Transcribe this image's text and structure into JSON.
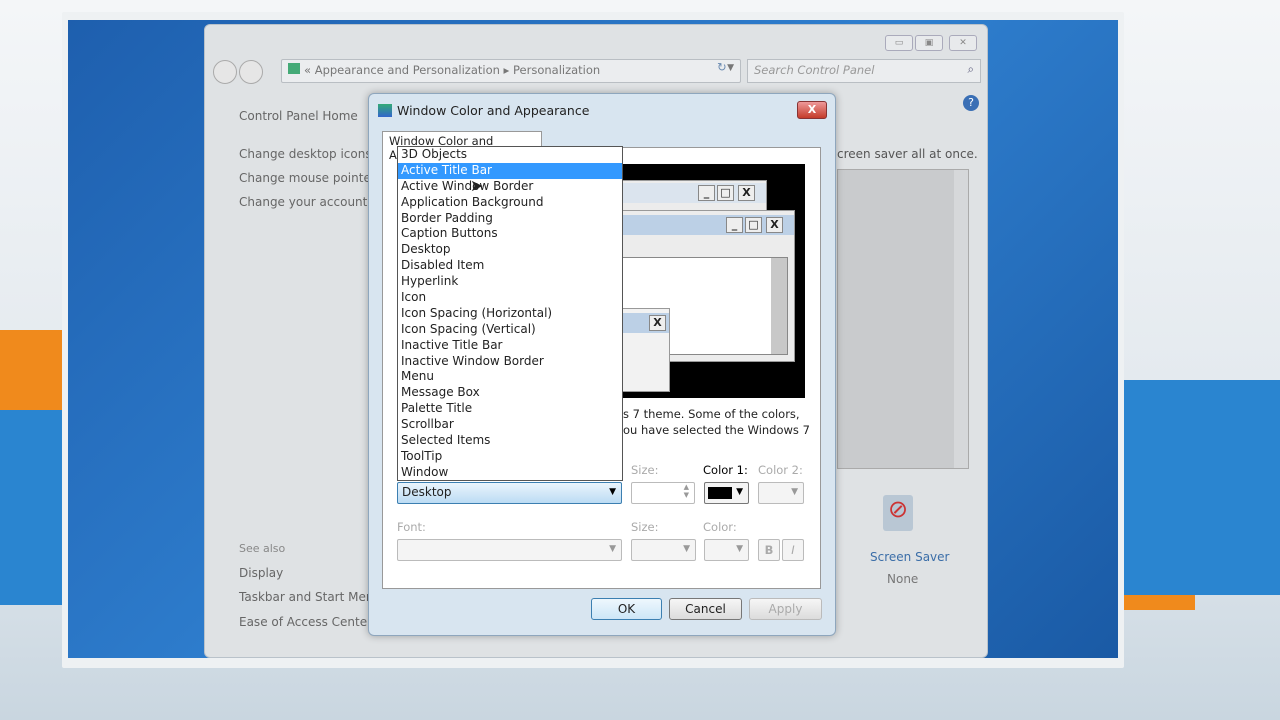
{
  "control_panel": {
    "breadcrumb": [
      "Appearance and Personalization",
      "Personalization"
    ],
    "search_placeholder": "Search Control Panel",
    "sidebar": [
      "Control Panel Home",
      "Change desktop icons",
      "Change mouse pointers",
      "Change your account pi"
    ],
    "see_also": {
      "heading": "See also",
      "items": [
        "Display",
        "Taskbar and Start Menu",
        "Ease of Access Center"
      ]
    },
    "partial_text": "creen saver all at once.",
    "screen_saver": {
      "label": "Screen Saver",
      "value": "None"
    },
    "window_buttons": {
      "minimize": "▭",
      "maximize": "▣",
      "close": "✕"
    }
  },
  "dialog": {
    "title": "Window Color and Appearance",
    "tab": "Window Color and Appearance",
    "close": "X",
    "description": [
      "s 7 theme.  Some of the colors,",
      "ou have selected the Windows 7"
    ],
    "item_list": [
      "3D Objects",
      "Active Title Bar",
      "Active Window Border",
      "Application Background",
      "Border Padding",
      "Caption Buttons",
      "Desktop",
      "Disabled Item",
      "Hyperlink",
      "Icon",
      "Icon Spacing (Horizontal)",
      "Icon Spacing (Vertical)",
      "Inactive Title Bar",
      "Inactive Window Border",
      "Menu",
      "Message Box",
      "Palette Title",
      "Scrollbar",
      "Selected Items",
      "ToolTip",
      "Window"
    ],
    "highlighted_item": "Active Title Bar",
    "item_value": "Desktop",
    "size_label": "Size:",
    "color1_label": "Color 1:",
    "color1_value": "#000000",
    "color2_label": "Color 2:",
    "font_label": "Font:",
    "font_size_label": "Size:",
    "font_color_label": "Color:",
    "bold": "B",
    "italic": "I",
    "ok": "OK",
    "cancel": "Cancel",
    "apply": "Apply",
    "preview_caption": {
      "min": "_",
      "max": "□",
      "close": "X"
    }
  }
}
